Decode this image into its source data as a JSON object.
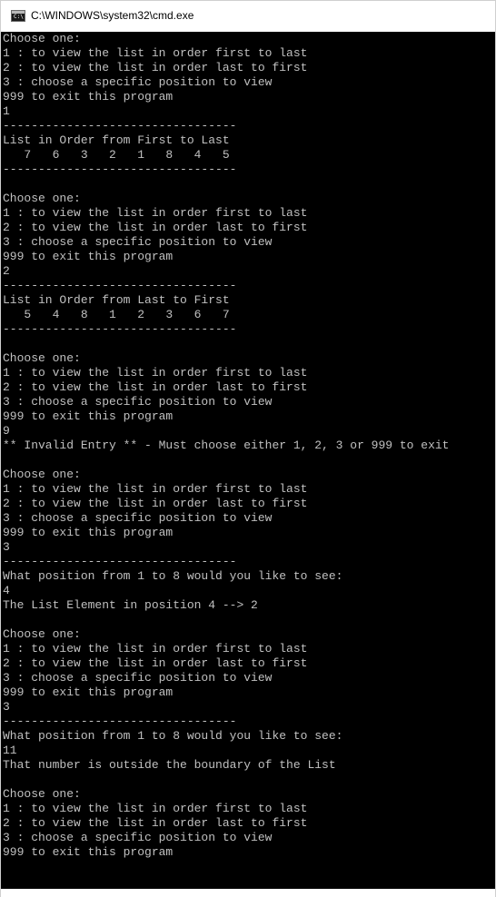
{
  "window": {
    "title": "C:\\WINDOWS\\system32\\cmd.exe",
    "icon": "cmd-icon"
  },
  "colors": {
    "console_background": "#000000",
    "console_text": "#c0c0c0",
    "titlebar_background": "#ffffff"
  },
  "console": {
    "lines": [
      "Choose one:",
      "1 : to view the list in order first to last",
      "2 : to view the list in order last to first",
      "3 : choose a specific position to view",
      "999 to exit this program",
      "1",
      "---------------------------------",
      "List in Order from First to Last",
      "   7   6   3   2   1   8   4   5",
      "---------------------------------",
      "",
      "Choose one:",
      "1 : to view the list in order first to last",
      "2 : to view the list in order last to first",
      "3 : choose a specific position to view",
      "999 to exit this program",
      "2",
      "---------------------------------",
      "List in Order from Last to First",
      "   5   4   8   1   2   3   6   7",
      "---------------------------------",
      "",
      "Choose one:",
      "1 : to view the list in order first to last",
      "2 : to view the list in order last to first",
      "3 : choose a specific position to view",
      "999 to exit this program",
      "9",
      "** Invalid Entry ** - Must choose either 1, 2, 3 or 999 to exit",
      "",
      "Choose one:",
      "1 : to view the list in order first to last",
      "2 : to view the list in order last to first",
      "3 : choose a specific position to view",
      "999 to exit this program",
      "3",
      "---------------------------------",
      "What position from 1 to 8 would you like to see:",
      "4",
      "The List Element in position 4 --> 2",
      "",
      "Choose one:",
      "1 : to view the list in order first to last",
      "2 : to view the list in order last to first",
      "3 : choose a specific position to view",
      "999 to exit this program",
      "3",
      "---------------------------------",
      "What position from 1 to 8 would you like to see:",
      "11",
      "That number is outside the boundary of the List",
      "",
      "Choose one:",
      "1 : to view the list in order first to last",
      "2 : to view the list in order last to first",
      "3 : choose a specific position to view",
      "999 to exit this program"
    ]
  }
}
